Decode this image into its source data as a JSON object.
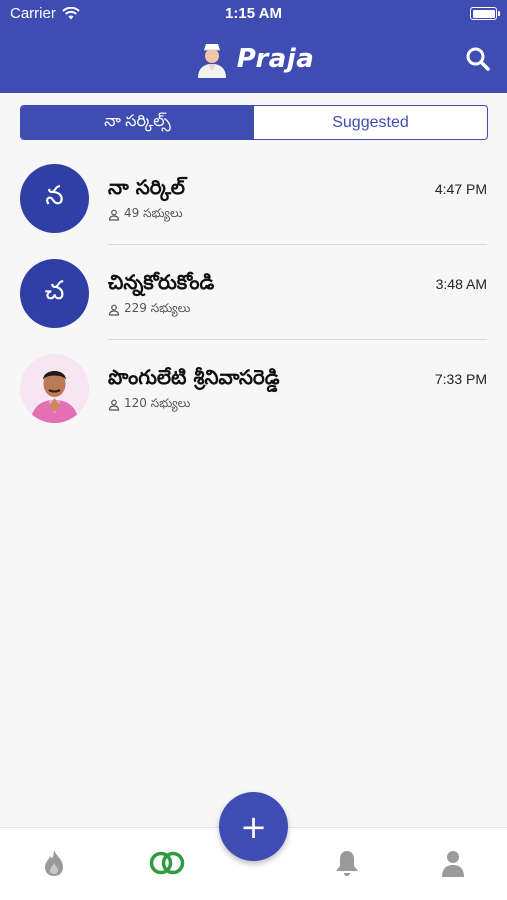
{
  "status_bar": {
    "carrier": "Carrier",
    "time": "1:15 AM"
  },
  "header": {
    "app_title": "Praja",
    "search_icon": "search-icon",
    "logo_icon": "leader-avatar-logo"
  },
  "tabs": {
    "my_circles": "నా సర్కిల్స్",
    "suggested": "Suggested",
    "active": "my_circles"
  },
  "circles": [
    {
      "title": "నా సర్కిల్",
      "avatar_letter": "న",
      "members": "49 సభ్యులు",
      "time": "4:47 PM"
    },
    {
      "title": "చిన్నకోరుకోండి",
      "avatar_letter": "చ",
      "members": "229 సభ్యులు",
      "time": "3:48 AM"
    },
    {
      "title": "పొంగులేటి శ్రీనివాసరెడ్డి",
      "avatar_letter": "",
      "members": "120 సభ్యులు",
      "time": "7:33 PM"
    }
  ],
  "fab": {
    "label": "+"
  },
  "bottom_nav": [
    "trending-flame-icon",
    "circles-rings-icon",
    "notifications-bell-icon",
    "profile-person-icon"
  ],
  "colors": {
    "primary": "#3f4db3",
    "active_tab_icon": "#2e9b3f",
    "inactive_icon": "#9a9a9a"
  }
}
